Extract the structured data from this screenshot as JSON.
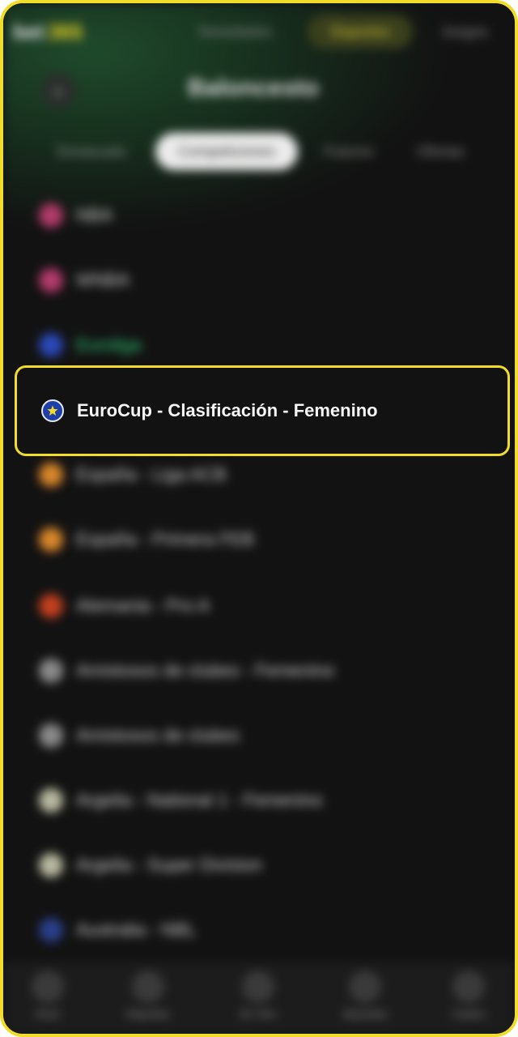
{
  "brand": {
    "logo_part1": "bet",
    "logo_part2": "365"
  },
  "top_nav": [
    "Novedades",
    "Deportes",
    "Juegos"
  ],
  "header": {
    "back_icon": "chevron-left-icon",
    "title": "Baloncesto"
  },
  "tabs": [
    {
      "label": "Destacado",
      "active": false
    },
    {
      "label": "Competiciones",
      "active": true
    },
    {
      "label": "Futuros",
      "active": false
    },
    {
      "label": "Ofertas",
      "active": false
    }
  ],
  "competitions": [
    {
      "label": "NBA",
      "icon": "usa-flag-icon",
      "color": "#b23b6a"
    },
    {
      "label": "WNBA",
      "icon": "usa-flag-icon",
      "color": "#b23b6a"
    },
    {
      "label": "Euroliga",
      "icon": "europe-flag-icon",
      "color": "#2a49b8",
      "highlight_text": true
    },
    {
      "label": "EuroCup - Clasificación - Femenino",
      "icon": "europe-flag-icon",
      "color": "#1f3fa8",
      "selected": true
    },
    {
      "label": "España - Liga ACB",
      "icon": "spain-flag-icon",
      "color": "#d9862a"
    },
    {
      "label": "España - Primera FEB",
      "icon": "spain-flag-icon",
      "color": "#d9862a"
    },
    {
      "label": "Alemania - Pro A",
      "icon": "germany-flag-icon",
      "color": "#c3401f"
    },
    {
      "label": "Amistosos de clubes - Femenino",
      "icon": "globe-icon",
      "color": "#8a8a8a"
    },
    {
      "label": "Amistosos de clubes",
      "icon": "globe-icon",
      "color": "#8a8a8a"
    },
    {
      "label": "Argelia - National 1 - Femenino",
      "icon": "algeria-flag-icon",
      "color": "#b9b9a0"
    },
    {
      "label": "Argelia - Super Division",
      "icon": "algeria-flag-icon",
      "color": "#b9b9a0"
    },
    {
      "label": "Australia - NBL",
      "icon": "australia-flag-icon",
      "color": "#2a3f8a"
    }
  ],
  "bottom_nav": [
    {
      "label": "Inicio",
      "icon": "home-icon"
    },
    {
      "label": "Deportes",
      "icon": "search-icon"
    },
    {
      "label": "En Vivo",
      "icon": "live-icon"
    },
    {
      "label": "Apuestas",
      "icon": "ticket-icon"
    },
    {
      "label": "Casino",
      "icon": "casino-icon"
    }
  ],
  "colors": {
    "accent": "#f2dc2a",
    "background": "#121212",
    "live_green": "#2fd07a"
  }
}
